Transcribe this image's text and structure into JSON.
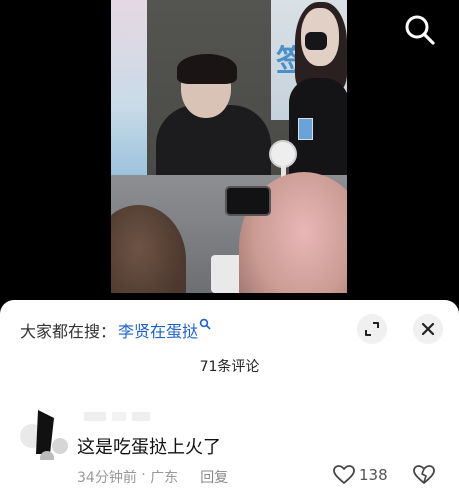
{
  "video": {
    "banner_glyph": "签"
  },
  "toolbar": {
    "search_icon": "search-icon"
  },
  "hot_search": {
    "prefix": "大家都在搜：",
    "query": "李贤在蛋挞",
    "link_color": "#1e62c9"
  },
  "controls": {
    "collapse_icon": "collapse-icon",
    "close_icon": "close-icon"
  },
  "comments_header": {
    "count_label": "71条评论"
  },
  "comment": {
    "text": "这是吃蛋挞上火了",
    "time": "34分钟前",
    "separator": " · ",
    "location": "广东",
    "reply_label": "回复",
    "likes": "138"
  }
}
